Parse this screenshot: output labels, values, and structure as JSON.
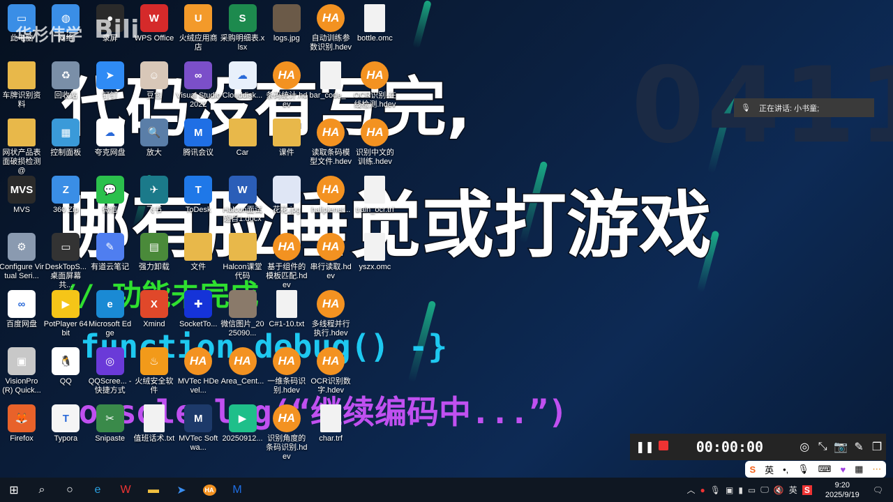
{
  "watermark": "华杉伟学",
  "watermark_brand": "bilibili",
  "overlay": {
    "line1": "代码没有写完,",
    "line2": "哪有脸睡觉或打游戏",
    "comment": "// 功能未完成",
    "func": "function debug() -}",
    "console": "console.log(“继续编码中...”)",
    "bg_number": "0411"
  },
  "voice": {
    "text": "正在讲话: 小书童;"
  },
  "recorder": {
    "time": "00:00:00"
  },
  "ime": {
    "lang": "英"
  },
  "taskbar": {
    "tray_lang": "英",
    "time": "9:20",
    "date": "2025/9/19"
  },
  "desktop_rows": [
    [
      {
        "l": "此电脑",
        "k": "app",
        "c": "#3a8ee6",
        "g": "▭"
      },
      {
        "l": "网络",
        "k": "app",
        "c": "#3a8ee6",
        "g": "◍"
      },
      {
        "l": "录屏",
        "k": "app",
        "c": "#2a2a2a",
        "g": "●"
      },
      {
        "l": "WPS Office",
        "k": "app",
        "c": "#d52a2a",
        "g": "W"
      },
      {
        "l": "火绒应用商店",
        "k": "app",
        "c": "#f39a2a",
        "g": "U"
      },
      {
        "l": "采购明细表.xlsx",
        "k": "app",
        "c": "#1d8a4e",
        "g": "S"
      },
      {
        "l": "logs.jpg",
        "k": "app",
        "c": "#6b5a48",
        "g": ""
      },
      {
        "l": "自动训练参数识别.hdev",
        "k": "ha"
      },
      {
        "l": "bottle.omc",
        "k": "file"
      }
    ],
    [
      {
        "l": "车牌识别资料",
        "k": "folder"
      },
      {
        "l": "回收站",
        "k": "app",
        "c": "#7a8fa8",
        "g": "♻"
      },
      {
        "l": "钉钉",
        "k": "app",
        "c": "#2f8bf5",
        "g": "➤"
      },
      {
        "l": "豆包",
        "k": "app",
        "c": "#d8c7b8",
        "g": "☺"
      },
      {
        "l": "Visual Studio 2022",
        "k": "app",
        "c": "#7b4fc9",
        "g": "∞"
      },
      {
        "l": "Clouddisk...",
        "k": "app",
        "c": "#e8f0fb",
        "g": "☁"
      },
      {
        "l": "条码统计.hdev",
        "k": "ha"
      },
      {
        "l": "bar_code_...",
        "k": "file"
      },
      {
        "l": "OCR识别-在线检测.hdev",
        "k": "ha"
      }
    ],
    [
      {
        "l": "网状产品表面破损检测@",
        "k": "folder"
      },
      {
        "l": "控制面板",
        "k": "app",
        "c": "#3a9ad9",
        "g": "▦"
      },
      {
        "l": "夸克网盘",
        "k": "app",
        "c": "#ffffff",
        "g": "☁"
      },
      {
        "l": "放大",
        "k": "app",
        "c": "#5a7ea8",
        "g": "🔍"
      },
      {
        "l": "腾讯会议",
        "k": "app",
        "c": "#1f6fe5",
        "g": "M"
      },
      {
        "l": "Car",
        "k": "folder"
      },
      {
        "l": "课件",
        "k": "folder"
      },
      {
        "l": "读取条码模型文件.hdev",
        "k": "ha"
      },
      {
        "l": "识别中文的训练.hdev",
        "k": "ha"
      }
    ],
    [
      {
        "l": "MVS",
        "k": "app",
        "c": "#2a2a2a",
        "g": "MVS"
      },
      {
        "l": "360 Zip",
        "k": "app",
        "c": "#3a8ee6",
        "g": "Z"
      },
      {
        "l": "微信",
        "k": "app",
        "c": "#2bc04c",
        "g": "💬"
      },
      {
        "l": "飞书",
        "k": "app",
        "c": "#1b7a8a",
        "g": "✈"
      },
      {
        "l": "ToDesk",
        "k": "app",
        "c": "#1f78e8",
        "g": "T"
      },
      {
        "l": "Halcon面试题目1.docx",
        "k": "app",
        "c": "#2b5eb8",
        "g": "W"
      },
      {
        "l": "花花.jpg",
        "k": "app",
        "c": "#dfe6f5",
        "g": ""
      },
      {
        "l": "halipienet...",
        "k": "ha"
      },
      {
        "l": "train_ocr.trf",
        "k": "file"
      }
    ],
    [
      {
        "l": "Configure Virtual Seri...",
        "k": "app",
        "c": "#8a9ab0",
        "g": "⚙"
      },
      {
        "l": "DeskTopS... 桌面屏幕共...",
        "k": "app",
        "c": "#333",
        "g": "▭"
      },
      {
        "l": "有道云笔记",
        "k": "app",
        "c": "#4f7ef0",
        "g": "✎"
      },
      {
        "l": "强力卸载",
        "k": "app",
        "c": "#4a8a3a",
        "g": "▤"
      },
      {
        "l": "文件",
        "k": "folder"
      },
      {
        "l": "Halcon课堂代码",
        "k": "folder"
      },
      {
        "l": "基于组件的模板匹配.hdev",
        "k": "ha"
      },
      {
        "l": "串行读取.hdev",
        "k": "ha"
      },
      {
        "l": "yszx.omc",
        "k": "file"
      }
    ],
    [
      {
        "l": "百度网盘",
        "k": "app",
        "c": "#ffffff",
        "g": "∞"
      },
      {
        "l": "PotPlayer 64 bit",
        "k": "app",
        "c": "#f5c518",
        "g": "▶"
      },
      {
        "l": "Microsoft Edge",
        "k": "app",
        "c": "#1a8ad4",
        "g": "e"
      },
      {
        "l": "Xmind",
        "k": "app",
        "c": "#e0482a",
        "g": "X"
      },
      {
        "l": "SocketTo...",
        "k": "app",
        "c": "#1533d8",
        "g": "✚"
      },
      {
        "l": "微信图片_2025090...",
        "k": "app",
        "c": "#8a7a6a",
        "g": ""
      },
      {
        "l": "C#1-10.txt",
        "k": "file"
      },
      {
        "l": "多线程并行执行.hdev",
        "k": "ha"
      }
    ],
    [
      {
        "l": "VisionPro (R) Quick...",
        "k": "app",
        "c": "#c8c8c8",
        "g": "▣"
      },
      {
        "l": "QQ",
        "k": "app",
        "c": "#ffffff",
        "g": "🐧"
      },
      {
        "l": "QQScree... - 快捷方式",
        "k": "app",
        "c": "#6a3ad8",
        "g": "◎"
      },
      {
        "l": "火绒安全软件",
        "k": "app",
        "c": "#f29a1a",
        "g": "♨"
      },
      {
        "l": "MVTec HDevel...",
        "k": "ha"
      },
      {
        "l": "Area_Cent...",
        "k": "ha"
      },
      {
        "l": "一维条码识别.hdev",
        "k": "ha"
      },
      {
        "l": "OCR识别数字.hdev",
        "k": "ha"
      }
    ],
    [
      {
        "l": "Firefox",
        "k": "app",
        "c": "#e8622a",
        "g": "🦊"
      },
      {
        "l": "Typora",
        "k": "app",
        "c": "#f5f5f5",
        "g": "T"
      },
      {
        "l": "Snipaste",
        "k": "app",
        "c": "#3a8a4a",
        "g": "✂"
      },
      {
        "l": "值班话术.txt",
        "k": "file"
      },
      {
        "l": "MVTec Softwa...",
        "k": "app",
        "c": "#1d3a6a",
        "g": "M"
      },
      {
        "l": "20250912...",
        "k": "app",
        "c": "#1fbf8a",
        "g": "▶"
      },
      {
        "l": "识别角度的条码识别.hdev",
        "k": "ha"
      },
      {
        "l": "char.trf",
        "k": "file"
      }
    ]
  ]
}
